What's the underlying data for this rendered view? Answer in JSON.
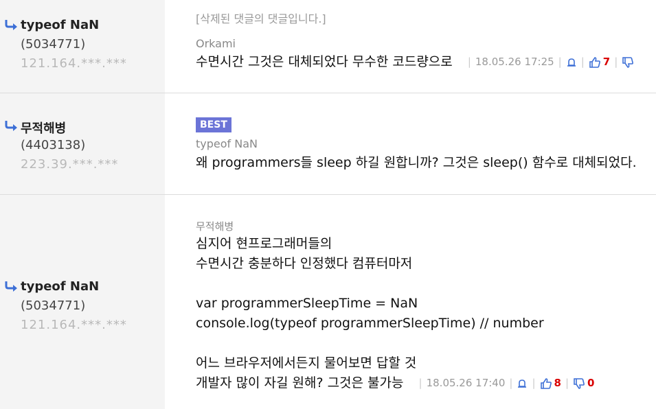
{
  "comments": [
    {
      "nick": "typeof NaN",
      "uid": "(5034771)",
      "ip": "121.164.***.***",
      "deleted_notice": "[삭제된 댓글의 댓글입니다.]",
      "author": "Orkami",
      "content": "수면시간 그것은 대체되었다 무수한 코드량으로",
      "timestamp": "18.05.26 17:25",
      "likes": "7"
    },
    {
      "nick": "무적해병",
      "uid": "(4403138)",
      "ip": "223.39.***.***",
      "badge": "BEST",
      "author": "typeof NaN",
      "content": "왜 programmers들 sleep 하길 원합니까? 그것은 sleep() 함수로 대체되었다."
    },
    {
      "nick": "typeof NaN",
      "uid": "(5034771)",
      "ip": "121.164.***.***",
      "author": "무적해병",
      "lines": [
        "심지어 현프로그래머들의",
        "수면시간 충분하다 인정했다 컴퓨터마저",
        "",
        "var programmerSleepTime = NaN",
        "console.log(typeof programmerSleepTime) // number",
        "",
        "어느 브라우저에서든지 물어보면 답할 것"
      ],
      "last_line": "개발자 많이 자길 원해? 그것은 불가능",
      "timestamp": "18.05.26 17:40",
      "likes": "8",
      "dislikes": "0"
    }
  ],
  "colors": {
    "accent": "#3d6fd6",
    "count": "#d90000",
    "badge": "#6b74d7"
  }
}
